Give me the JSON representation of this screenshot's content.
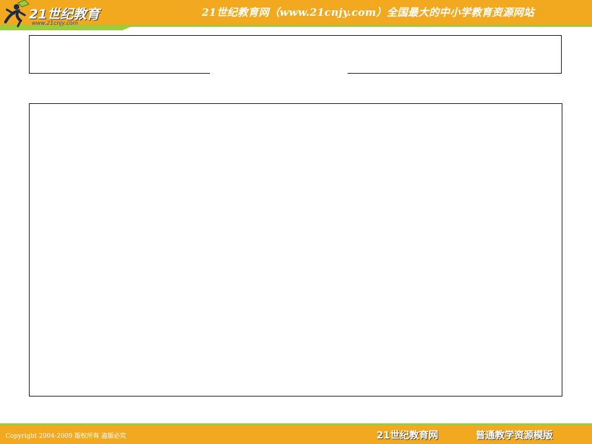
{
  "header": {
    "logo_text": "21世纪教育",
    "logo_url": "www.21cnjy.com",
    "slogan": "21世纪教育网（www.21cnjy.com）全国最大的中小学教育资源网站"
  },
  "slide": {
    "title": "",
    "body": ""
  },
  "footer": {
    "copyright": "Copyright 2004-2009 版权所有 盗版必究",
    "brand": "21世纪教育网",
    "tagline": "普通教学资源模版"
  },
  "colors": {
    "header_orange": "#f2a81f",
    "accent_green": "#9ccc3a",
    "logo_blue": "#2c4a88"
  },
  "icons": {
    "logo_figure": "runner-figure-icon"
  }
}
